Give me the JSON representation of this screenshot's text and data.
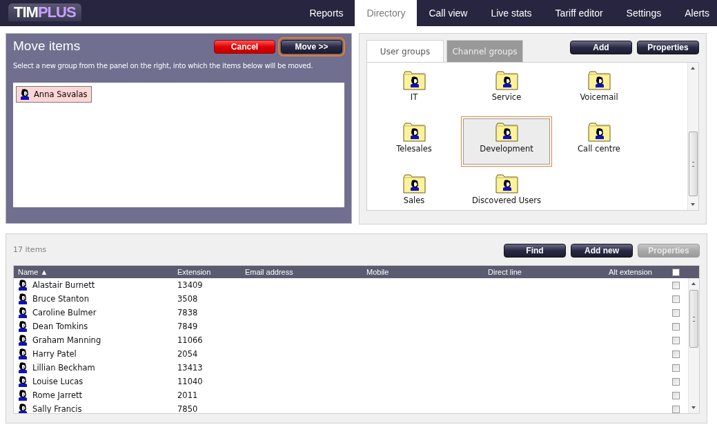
{
  "logo": {
    "part_1": "TIM",
    "part_2": "PLUS"
  },
  "nav": [
    {
      "label": "Reports",
      "selected": false
    },
    {
      "label": "Directory",
      "selected": true
    },
    {
      "label": "Call view",
      "selected": false
    },
    {
      "label": "Live stats",
      "selected": false
    },
    {
      "label": "Tariff editor",
      "selected": false
    },
    {
      "label": "Settings",
      "selected": false
    },
    {
      "label": "Alerts",
      "selected": false
    }
  ],
  "move_panel": {
    "title": "Move items",
    "buttons": [
      {
        "label": "Cancel",
        "kind": "danger",
        "focused": false
      },
      {
        "label": "Move >>",
        "kind": "default",
        "focused": true
      }
    ],
    "instructions": "Select a new group from the panel on the right, into which the items below will be moved.",
    "items": [
      {
        "name": "Anna Savalas"
      }
    ]
  },
  "groups_panel": {
    "tabs": [
      {
        "label": "User groups",
        "selected": true
      },
      {
        "label": "Channel groups",
        "selected": false
      }
    ],
    "buttons": [
      {
        "label": "Add",
        "disabled": false
      },
      {
        "label": "Properties",
        "disabled": false
      }
    ],
    "groups": [
      {
        "name": "IT",
        "selected": false
      },
      {
        "name": "Service",
        "selected": false
      },
      {
        "name": "Voicemail",
        "selected": false
      },
      {
        "name": "Telesales",
        "selected": false
      },
      {
        "name": "Development",
        "selected": true
      },
      {
        "name": "Call centre",
        "selected": false
      },
      {
        "name": "Sales",
        "selected": false
      },
      {
        "name": "Discovered Users",
        "selected": false
      }
    ]
  },
  "users_panel": {
    "count": "17 items",
    "buttons": [
      {
        "label": "Find",
        "disabled": false
      },
      {
        "label": "Add new",
        "disabled": false
      },
      {
        "label": "Properties",
        "disabled": true
      }
    ],
    "columns": [
      "Name ▲",
      "Extension",
      "Email address",
      "Mobile",
      "Direct line",
      "Alt extension"
    ],
    "select_all_checked": false,
    "rows": [
      {
        "name": "Alastair Burnett",
        "extension": "13409",
        "checked": false
      },
      {
        "name": "Bruce Stanton",
        "extension": "3508",
        "checked": false
      },
      {
        "name": "Caroline Bulmer",
        "extension": "7838",
        "checked": false
      },
      {
        "name": "Dean Tomkins",
        "extension": "7849",
        "checked": false
      },
      {
        "name": "Graham Manning",
        "extension": "11066",
        "checked": false
      },
      {
        "name": "Harry Patel",
        "extension": "2054",
        "checked": false
      },
      {
        "name": "Lillian Beckham",
        "extension": "13413",
        "checked": false
      },
      {
        "name": "Louise Lucas",
        "extension": "11040",
        "checked": false
      },
      {
        "name": "Rome Jarrett",
        "extension": "2011",
        "checked": false
      },
      {
        "name": "Sally Francis",
        "extension": "7850",
        "checked": false
      }
    ]
  }
}
